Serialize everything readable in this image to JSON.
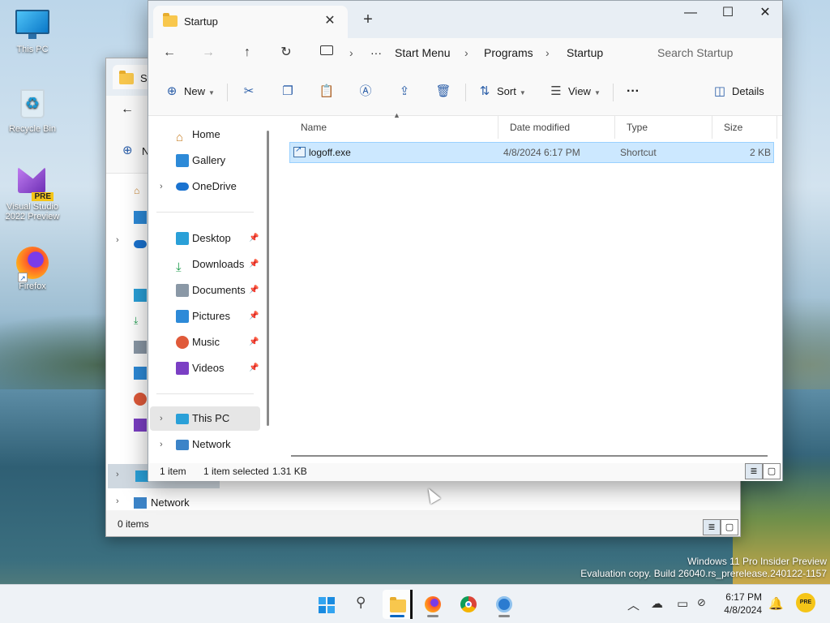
{
  "desktop": {
    "icons": [
      {
        "label": "This PC"
      },
      {
        "label": "Recycle Bin"
      },
      {
        "label": "Visual Studio 2022 Preview",
        "badge": "PRE"
      },
      {
        "label": "Firefox"
      }
    ],
    "watermark": {
      "line1": "Windows 11 Pro Insider Preview",
      "line2": "Evaluation copy. Build 26040.rs_prerelease.240122-1157"
    }
  },
  "back_window": {
    "tab_title": "St",
    "new_label": "N",
    "network_label": "Network",
    "status": "0 items"
  },
  "window": {
    "tab_title": "Startup",
    "tab_close": "✕",
    "new_tab": "+",
    "controls": {
      "minimize": "—",
      "maximize": "☐",
      "close": "✕"
    },
    "nav": {
      "back": "←",
      "forward": "→",
      "up": "↑",
      "refresh": "↻"
    },
    "breadcrumb": [
      "Start Menu",
      "Programs",
      "Startup"
    ],
    "breadcrumb_more": "···",
    "search_placeholder": "Search Startup",
    "commands": {
      "new": "New",
      "sort": "Sort",
      "view": "View",
      "more": "···",
      "details": "Details"
    },
    "sidebar": [
      {
        "label": "Home",
        "icon": "home-icon"
      },
      {
        "label": "Gallery",
        "icon": "gallery-icon"
      },
      {
        "label": "OneDrive",
        "icon": "onedrive-icon"
      },
      {
        "label": "Desktop",
        "icon": "desktop-icon",
        "pinned": true
      },
      {
        "label": "Downloads",
        "icon": "download-icon",
        "pinned": true
      },
      {
        "label": "Documents",
        "icon": "documents-icon",
        "pinned": true
      },
      {
        "label": "Pictures",
        "icon": "pictures-icon",
        "pinned": true
      },
      {
        "label": "Music",
        "icon": "music-icon",
        "pinned": true
      },
      {
        "label": "Videos",
        "icon": "videos-icon",
        "pinned": true
      },
      {
        "label": "This PC",
        "icon": "this-pc-icon",
        "selected": true
      },
      {
        "label": "Network",
        "icon": "network-icon"
      }
    ],
    "columns": [
      "Name",
      "Date modified",
      "Type",
      "Size"
    ],
    "files": [
      {
        "name": "logoff.exe",
        "date": "4/8/2024 6:17 PM",
        "type": "Shortcut",
        "size": "2 KB"
      }
    ],
    "status": {
      "count": "1 item",
      "selected": "1 item selected",
      "size": "1.31 KB"
    }
  },
  "taskbar": {
    "apps": [
      "start-icon",
      "search-icon",
      "file-explorer-icon",
      "firefox-icon",
      "chrome-icon",
      "app-icon"
    ],
    "time": "6:17 PM",
    "date": "4/8/2024"
  },
  "colors": {
    "accent": "#0a67c2",
    "selection": "#cce8ff",
    "selection_border": "#99d1ff",
    "folder": "#f8c74d"
  }
}
